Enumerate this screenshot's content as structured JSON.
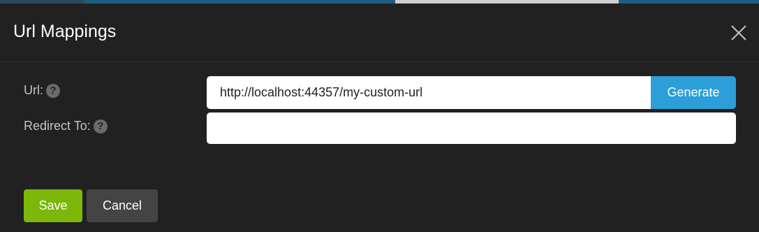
{
  "dialog": {
    "title": "Url Mappings",
    "close_icon": "close-icon"
  },
  "form": {
    "url": {
      "label": "Url:",
      "help_icon": "?",
      "value": "http://localhost:44357/my-custom-url",
      "generate_label": "Generate"
    },
    "redirect": {
      "label": "Redirect To:",
      "help_icon": "?",
      "value": ""
    }
  },
  "footer": {
    "save_label": "Save",
    "cancel_label": "Cancel"
  },
  "colors": {
    "primary": "#2c9fd9",
    "success": "#7cb70a",
    "background": "#212121"
  }
}
